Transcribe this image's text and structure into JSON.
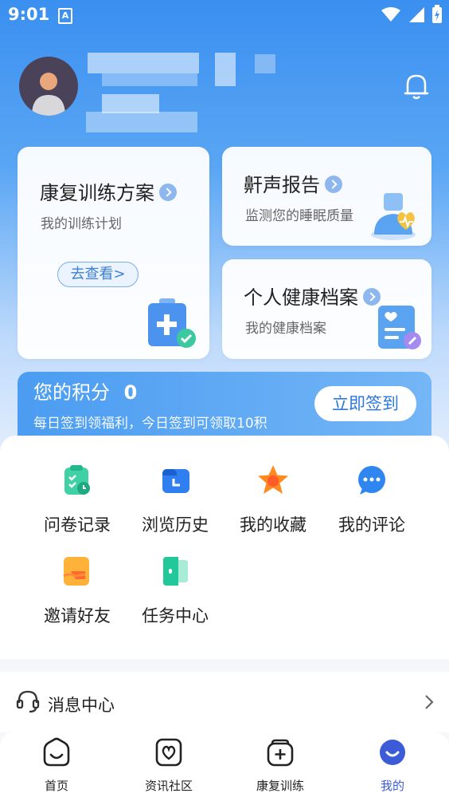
{
  "status_bar": {
    "time": "9:01"
  },
  "cards": {
    "rehab": {
      "title": "康复训练方案",
      "subtitle": "我的训练计划",
      "button": "去查看>"
    },
    "snore": {
      "title": "鼾声报告",
      "subtitle": "监测您的睡眠质量"
    },
    "health": {
      "title": "个人健康档案",
      "subtitle": "我的健康档案"
    }
  },
  "points": {
    "title": "您的积分",
    "value": "0",
    "desc": "每日签到领福利，今日签到可领取10积",
    "sign_button": "立即签到"
  },
  "grid": [
    {
      "label": "问卷记录",
      "icon": "clipboard-icon"
    },
    {
      "label": "浏览历史",
      "icon": "history-icon"
    },
    {
      "label": "我的收藏",
      "icon": "star-icon"
    },
    {
      "label": "我的评论",
      "icon": "comment-icon"
    },
    {
      "label": "邀请好友",
      "icon": "invite-icon"
    },
    {
      "label": "任务中心",
      "icon": "task-icon"
    }
  ],
  "message_center": {
    "label": "消息中心"
  },
  "tabbar": [
    {
      "label": "首页",
      "icon": "home-icon"
    },
    {
      "label": "资讯社区",
      "icon": "community-icon"
    },
    {
      "label": "康复训练",
      "icon": "rehab-icon"
    },
    {
      "label": "我的",
      "icon": "profile-icon",
      "active": true
    }
  ],
  "colors": {
    "accent": "#2c78e0",
    "active_tab": "#3b5cd6"
  }
}
